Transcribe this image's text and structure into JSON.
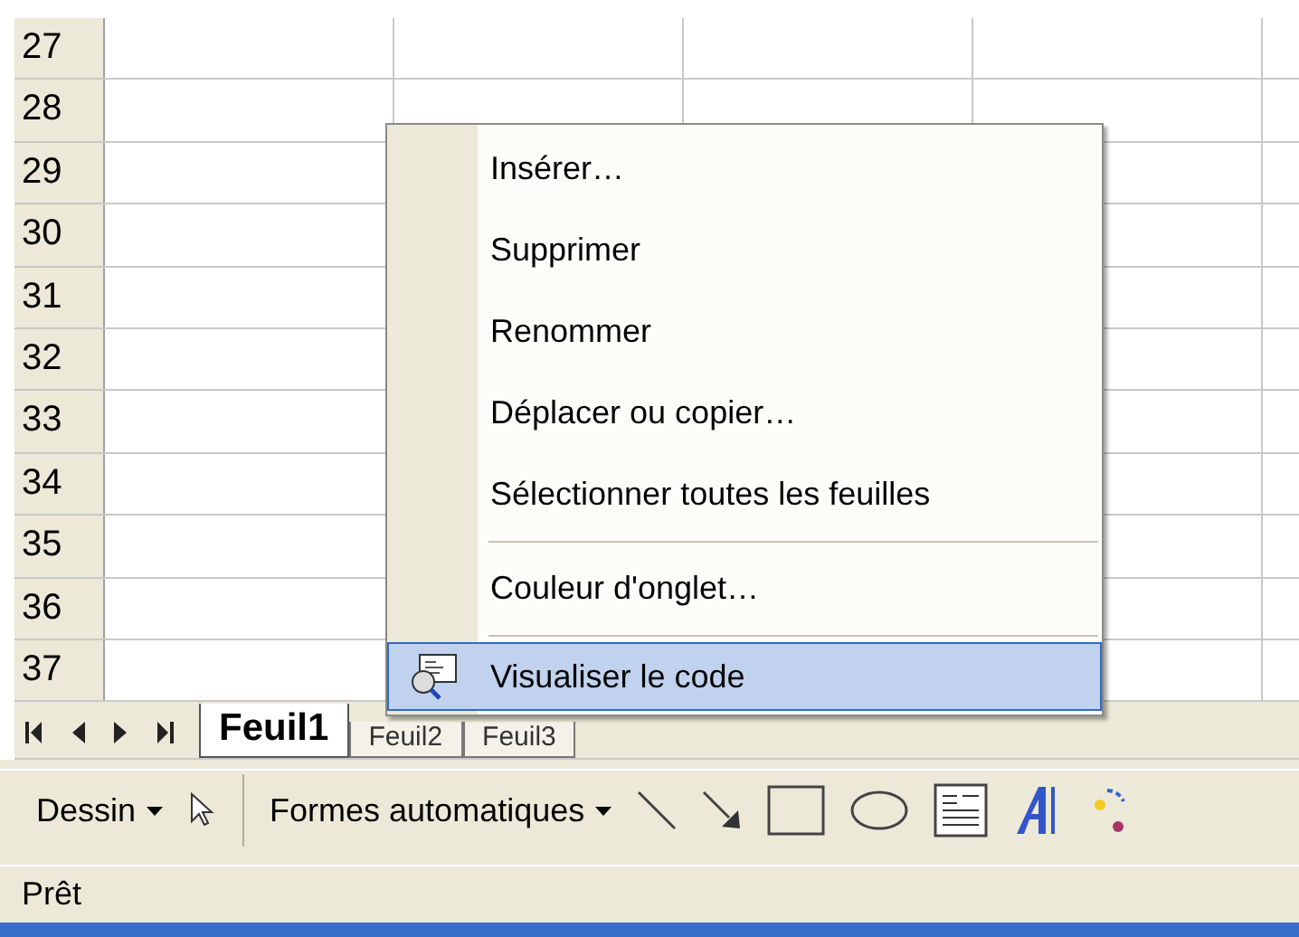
{
  "sheet": {
    "rows": [
      "27",
      "28",
      "29",
      "30",
      "31",
      "32",
      "33",
      "34",
      "35",
      "36",
      "37"
    ]
  },
  "context_menu": {
    "items": [
      {
        "kind": "item",
        "label": "Insérer…",
        "selected": false
      },
      {
        "kind": "item",
        "label": "Supprimer",
        "selected": false
      },
      {
        "kind": "item",
        "label": "Renommer",
        "selected": false
      },
      {
        "kind": "item",
        "label": "Déplacer ou copier…",
        "selected": false
      },
      {
        "kind": "item",
        "label": "Sélectionner toutes les feuilles",
        "selected": false
      },
      {
        "kind": "separator"
      },
      {
        "kind": "item",
        "label": "Couleur d'onglet…",
        "selected": false
      },
      {
        "kind": "separator"
      },
      {
        "kind": "icon_item",
        "label": "Visualiser le code",
        "selected": true
      }
    ]
  },
  "sheet_tabs": [
    {
      "label": "Feuil1",
      "selected": true
    },
    {
      "label": "Feuil2",
      "selected": false
    },
    {
      "label": "Feuil3",
      "selected": false
    }
  ],
  "drawing_toolbar": {
    "items": [
      {
        "kind": "menu",
        "label": "Dessin"
      },
      {
        "kind": "pointer"
      },
      {
        "kind": "divider"
      },
      {
        "kind": "menu",
        "label": "Formes automatiques"
      },
      {
        "kind": "line"
      },
      {
        "kind": "arrow"
      },
      {
        "kind": "rectangle"
      },
      {
        "kind": "oval"
      },
      {
        "kind": "textbox"
      },
      {
        "kind": "wordart"
      },
      {
        "kind": "diagram"
      }
    ]
  },
  "status_bar": {
    "text": "Prêt"
  }
}
